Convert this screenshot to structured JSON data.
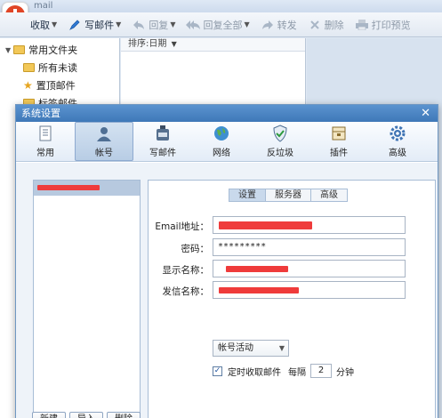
{
  "app": {
    "title": "mail"
  },
  "toolbar": {
    "receive": "收取",
    "compose": "写邮件",
    "reply": "回复",
    "reply_all": "回复全部",
    "forward": "转发",
    "delete": "删除",
    "print_preview": "打印预览"
  },
  "folders": {
    "root": "常用文件夹",
    "unread": "所有未读",
    "pinned": "置顶邮件",
    "partial": "标签邮件"
  },
  "list": {
    "sort_label": "排序:日期"
  },
  "dialog": {
    "title": "系统设置",
    "tabs": [
      "常用",
      "帐号",
      "写邮件",
      "网络",
      "反垃圾",
      "插件",
      "高级"
    ],
    "active_tab": "帐号",
    "subtabs": [
      "设置",
      "服务器",
      "高级"
    ],
    "active_subtab": "设置",
    "fields": {
      "email_label": "Email地址：",
      "password_label": "密码：",
      "password_value": "*********",
      "display_name_label": "显示名称：",
      "sender_name_label": "发信名称："
    },
    "account_status": "帐号活动",
    "auto_receive": {
      "label": "定时收取邮件",
      "every": "每隔",
      "interval": "2",
      "unit": "分钟",
      "checked": true
    },
    "buttons": {
      "new": "新建",
      "import": "导入",
      "delete": "删除"
    }
  },
  "colors": {
    "accent": "#3e78b8",
    "redaction": "#ef3b3b"
  }
}
